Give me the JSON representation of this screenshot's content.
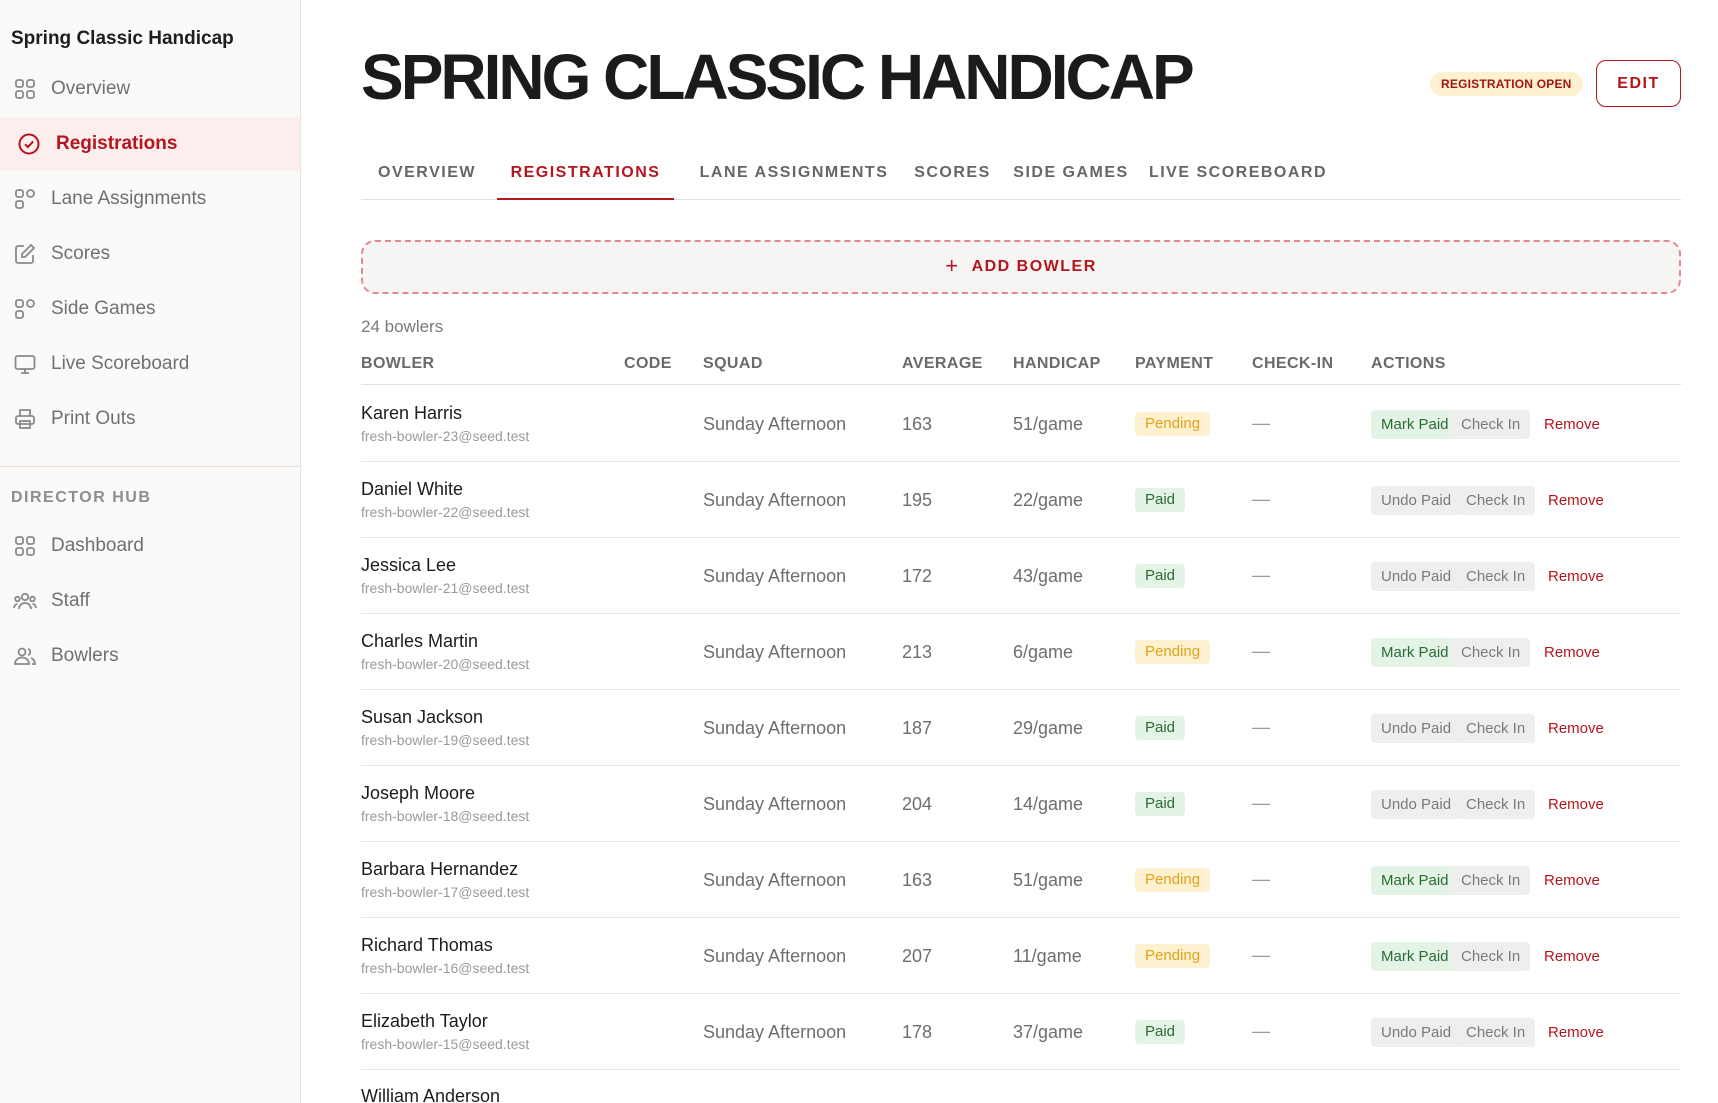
{
  "sidebar": {
    "title": "Spring Classic Handicap",
    "items": [
      {
        "label": "Overview",
        "icon": "grid-icon",
        "active": false
      },
      {
        "label": "Registrations",
        "icon": "check-circle-icon",
        "active": true
      },
      {
        "label": "Lane Assignments",
        "icon": "lanes-icon",
        "active": false
      },
      {
        "label": "Scores",
        "icon": "edit-icon",
        "active": false
      },
      {
        "label": "Side Games",
        "icon": "side-games-icon",
        "active": false
      },
      {
        "label": "Live Scoreboard",
        "icon": "monitor-icon",
        "active": false
      },
      {
        "label": "Print Outs",
        "icon": "printer-icon",
        "active": false
      }
    ],
    "section_label": "DIRECTOR HUB",
    "hub_items": [
      {
        "label": "Dashboard",
        "icon": "grid-icon"
      },
      {
        "label": "Staff",
        "icon": "staff-icon"
      },
      {
        "label": "Bowlers",
        "icon": "users-icon"
      }
    ]
  },
  "header": {
    "title": "SPRING CLASSIC HANDICAP",
    "status": "REGISTRATION OPEN",
    "edit_label": "EDIT"
  },
  "tabs": [
    {
      "label": "OVERVIEW",
      "active": false
    },
    {
      "label": "REGISTRATIONS",
      "active": true
    },
    {
      "label": "LANE ASSIGNMENTS",
      "active": false
    },
    {
      "label": "SCORES",
      "active": false
    },
    {
      "label": "SIDE GAMES",
      "active": false
    },
    {
      "label": "LIVE SCOREBOARD",
      "active": false
    }
  ],
  "add_bowler_label": "ADD BOWLER",
  "count_label": "24 bowlers",
  "columns": [
    "BOWLER",
    "CODE",
    "SQUAD",
    "AVERAGE",
    "HANDICAP",
    "PAYMENT",
    "CHECK-IN",
    "ACTIONS"
  ],
  "rows": [
    {
      "name": "Karen Harris",
      "email": "fresh-bowler-23@seed.test",
      "code": "",
      "squad": "Sunday Afternoon",
      "average": "163",
      "handicap": "51/game",
      "payment": "Pending",
      "checkin": "—",
      "pay_action": "Mark Paid",
      "checkin_action": "Check In",
      "remove_action": "Remove"
    },
    {
      "name": "Daniel White",
      "email": "fresh-bowler-22@seed.test",
      "code": "",
      "squad": "Sunday Afternoon",
      "average": "195",
      "handicap": "22/game",
      "payment": "Paid",
      "checkin": "—",
      "pay_action": "Undo Paid",
      "checkin_action": "Check In",
      "remove_action": "Remove"
    },
    {
      "name": "Jessica Lee",
      "email": "fresh-bowler-21@seed.test",
      "code": "",
      "squad": "Sunday Afternoon",
      "average": "172",
      "handicap": "43/game",
      "payment": "Paid",
      "checkin": "—",
      "pay_action": "Undo Paid",
      "checkin_action": "Check In",
      "remove_action": "Remove"
    },
    {
      "name": "Charles Martin",
      "email": "fresh-bowler-20@seed.test",
      "code": "",
      "squad": "Sunday Afternoon",
      "average": "213",
      "handicap": "6/game",
      "payment": "Pending",
      "checkin": "—",
      "pay_action": "Mark Paid",
      "checkin_action": "Check In",
      "remove_action": "Remove"
    },
    {
      "name": "Susan Jackson",
      "email": "fresh-bowler-19@seed.test",
      "code": "",
      "squad": "Sunday Afternoon",
      "average": "187",
      "handicap": "29/game",
      "payment": "Paid",
      "checkin": "—",
      "pay_action": "Undo Paid",
      "checkin_action": "Check In",
      "remove_action": "Remove"
    },
    {
      "name": "Joseph Moore",
      "email": "fresh-bowler-18@seed.test",
      "code": "",
      "squad": "Sunday Afternoon",
      "average": "204",
      "handicap": "14/game",
      "payment": "Paid",
      "checkin": "—",
      "pay_action": "Undo Paid",
      "checkin_action": "Check In",
      "remove_action": "Remove"
    },
    {
      "name": "Barbara Hernandez",
      "email": "fresh-bowler-17@seed.test",
      "code": "",
      "squad": "Sunday Afternoon",
      "average": "163",
      "handicap": "51/game",
      "payment": "Pending",
      "checkin": "—",
      "pay_action": "Mark Paid",
      "checkin_action": "Check In",
      "remove_action": "Remove"
    },
    {
      "name": "Richard Thomas",
      "email": "fresh-bowler-16@seed.test",
      "code": "",
      "squad": "Sunday Afternoon",
      "average": "207",
      "handicap": "11/game",
      "payment": "Pending",
      "checkin": "—",
      "pay_action": "Mark Paid",
      "checkin_action": "Check In",
      "remove_action": "Remove"
    },
    {
      "name": "Elizabeth Taylor",
      "email": "fresh-bowler-15@seed.test",
      "code": "",
      "squad": "Sunday Afternoon",
      "average": "178",
      "handicap": "37/game",
      "payment": "Paid",
      "checkin": "—",
      "pay_action": "Undo Paid",
      "checkin_action": "Check In",
      "remove_action": "Remove"
    },
    {
      "name": "William Anderson",
      "email": "",
      "code": "",
      "squad": "",
      "average": "",
      "handicap": "",
      "payment": "",
      "checkin": "",
      "pay_action": "",
      "checkin_action": "",
      "remove_action": ""
    }
  ],
  "colors": {
    "accent": "#b5151c",
    "paid_bg": "#e3f4e6",
    "paid_text": "#2c6a35",
    "pending_bg": "#fdf1cf",
    "pending_text": "#e3a11c"
  }
}
